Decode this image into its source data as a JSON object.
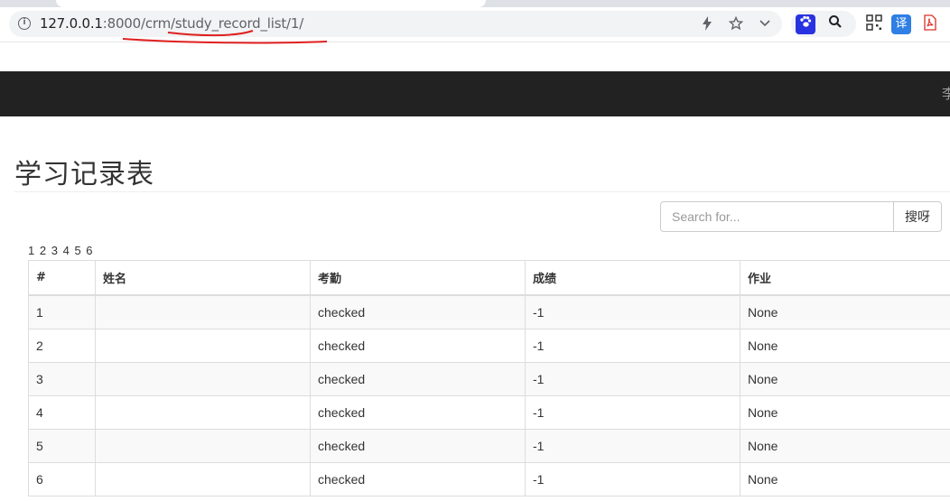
{
  "browser": {
    "url_host": "127.0.0.1",
    "url_path": ":8000/crm/study_record_list/1/",
    "icons": [
      "info-icon",
      "lightning-icon",
      "star-icon",
      "chevron-down-icon",
      "paw-icon",
      "search-icon",
      "qr-icon",
      "translate-icon",
      "pdf-icon"
    ],
    "translate_ext_label": "译"
  },
  "navbar": {
    "user": "李"
  },
  "page": {
    "title": "学习记录表"
  },
  "search": {
    "placeholder": "Search for...",
    "button_label": "搜呀"
  },
  "pagination": [
    "1",
    "2",
    "3",
    "4",
    "5",
    "6"
  ],
  "table": {
    "headers": [
      "#",
      "姓名",
      "考勤",
      "成绩",
      "作业"
    ],
    "rows": [
      [
        "1",
        "",
        "checked",
        "-1",
        "None"
      ],
      [
        "2",
        "",
        "checked",
        "-1",
        "None"
      ],
      [
        "3",
        "",
        "checked",
        "-1",
        "None"
      ],
      [
        "4",
        "",
        "checked",
        "-1",
        "None"
      ],
      [
        "5",
        "",
        "checked",
        "-1",
        "None"
      ],
      [
        "6",
        "",
        "checked",
        "-1",
        "None"
      ]
    ]
  },
  "colors": {
    "navbar_bg": "#222222",
    "annotation": "#e02020",
    "table_border": "#dddddd",
    "stripe": "#f9f9f9"
  }
}
